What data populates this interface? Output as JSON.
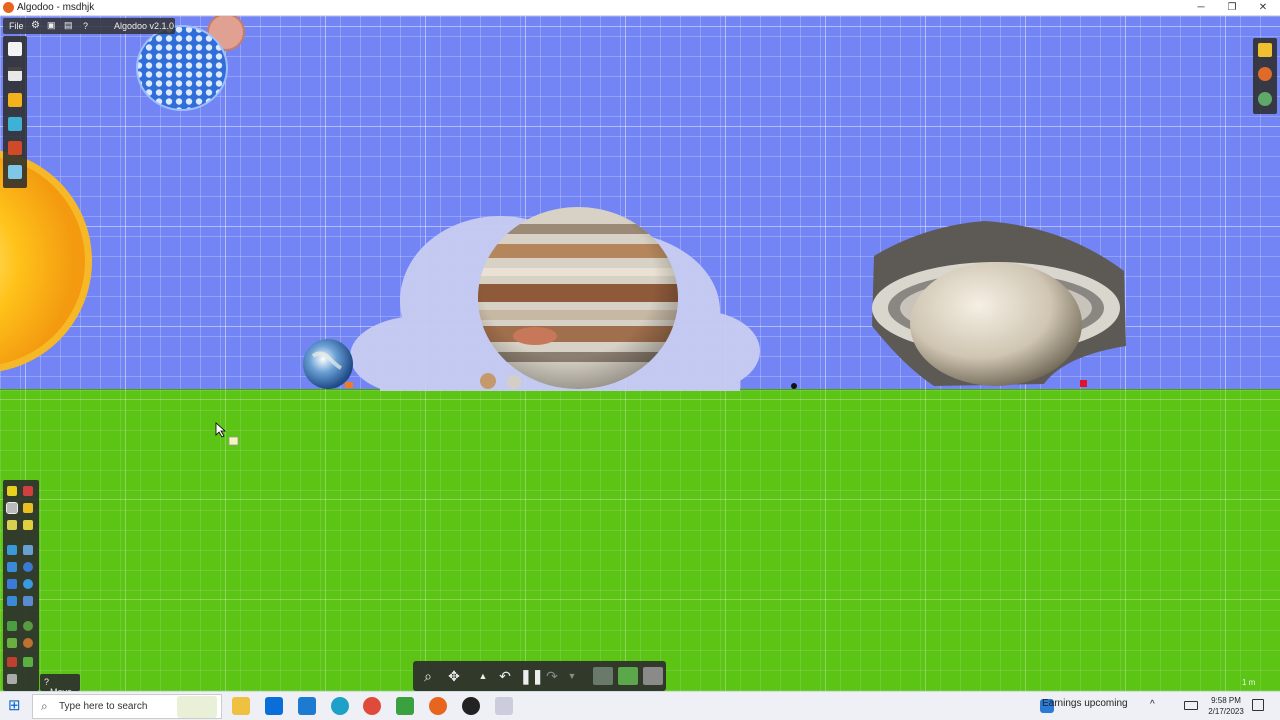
{
  "window": {
    "title": "Algodoo - msdhjk",
    "minimize": "─",
    "maximize": "❐",
    "close": "✕"
  },
  "menubar": {
    "file": "File",
    "version": "Algodoo v2.1.0",
    "help": "?"
  },
  "tools": {
    "move_help": "?",
    "move_label": "Move"
  },
  "scene": {
    "scale_label": "1 m"
  },
  "colors": {
    "sky": "#7385f4",
    "ground": "#5bc414",
    "panel": "#2d2d2d"
  },
  "taskbar": {
    "search_placeholder": "Type here to search",
    "earnings": "Earnings upcoming",
    "time": "9:58 PM",
    "date": "2/17/2023"
  }
}
